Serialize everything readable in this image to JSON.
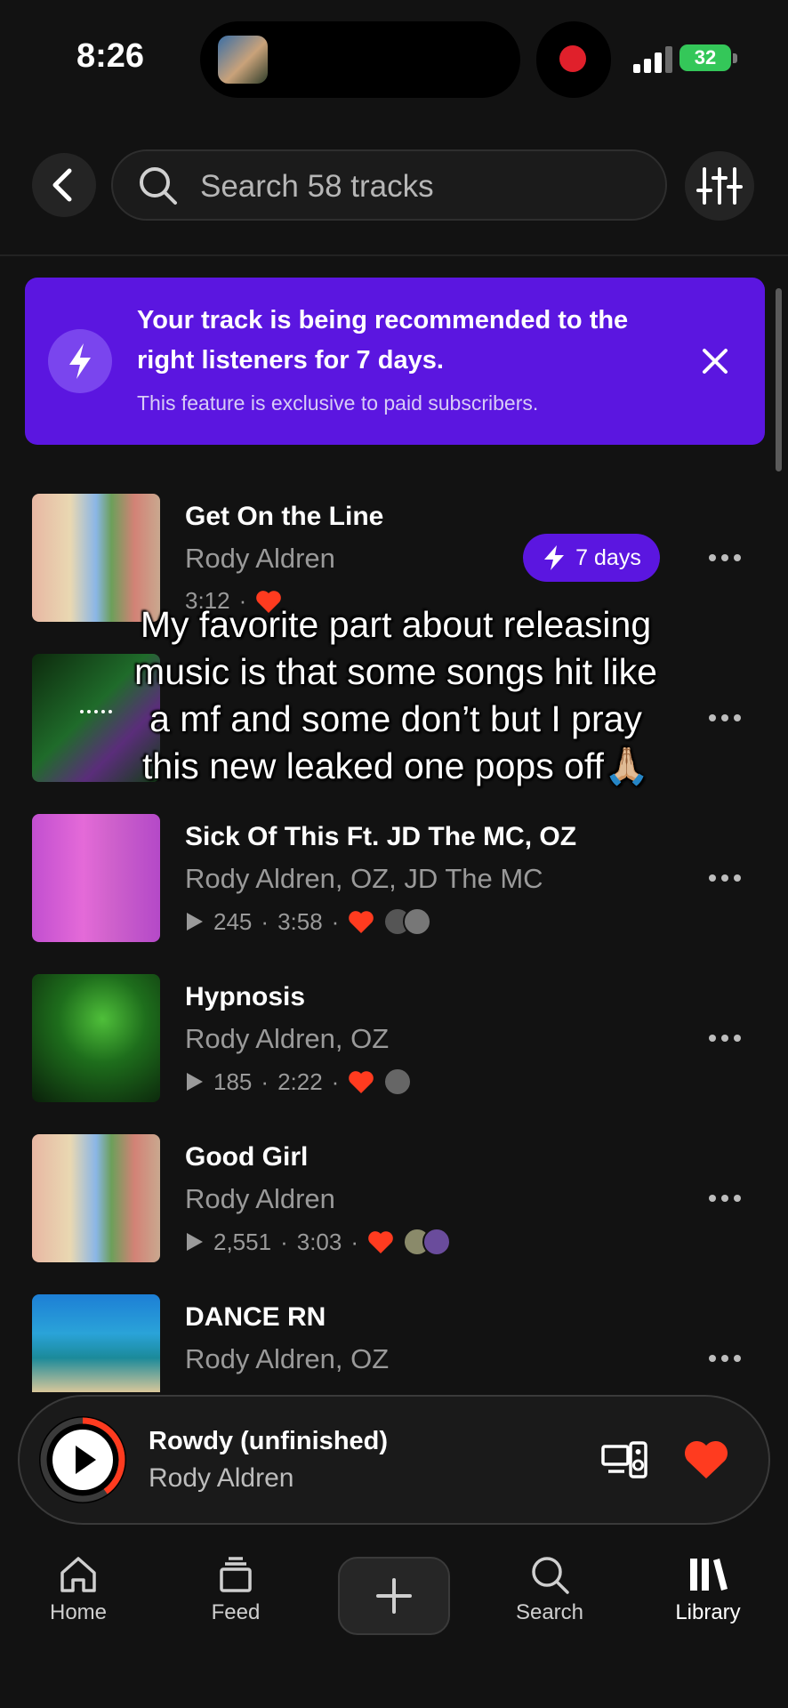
{
  "status_bar": {
    "time": "8:26",
    "battery": "32"
  },
  "search": {
    "placeholder": "Search 58 tracks"
  },
  "banner": {
    "title": "Your track is being recommended to the right listeners for 7 days.",
    "subtitle": "This feature is exclusive to paid subscribers.",
    "accent": "#5b16e0"
  },
  "tracks": [
    {
      "title": "Get On the Line",
      "artist": "Rody Aldren",
      "duration": "3:12",
      "badge": "7 days"
    },
    {
      "title": "",
      "artist": "",
      "plays": "",
      "duration": ""
    },
    {
      "title": "Sick Of This Ft. JD The MC, OZ",
      "artist": "Rody Aldren, OZ, JD The MC",
      "plays": "245",
      "duration": "3:58"
    },
    {
      "title": "Hypnosis",
      "artist": "Rody Aldren, OZ",
      "plays": "185",
      "duration": "2:22"
    },
    {
      "title": "Good Girl",
      "artist": "Rody Aldren",
      "plays": "2,551",
      "duration": "3:03"
    },
    {
      "title": "DANCE RN",
      "artist": "Rody Aldren, OZ"
    }
  ],
  "caption": "My favorite part about releasing music is that some songs hit like a mf and some don’t but I pray this new leaked one pops off🙏🏼",
  "now_playing": {
    "title": "Rowdy (unfinished)",
    "artist": "Rody Aldren",
    "progress": 0.4
  },
  "nav": {
    "home": "Home",
    "feed": "Feed",
    "search": "Search",
    "library": "Library"
  },
  "colors": {
    "heart": "#ff3b1f",
    "background": "#121212"
  }
}
